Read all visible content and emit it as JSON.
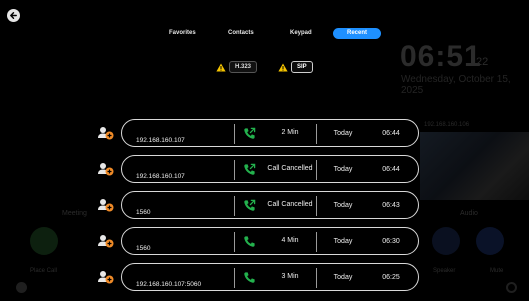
{
  "tabs": [
    {
      "label": "Favorites",
      "active": false
    },
    {
      "label": "Contacts",
      "active": false
    },
    {
      "label": "Keypad",
      "active": false
    },
    {
      "label": "Recent",
      "active": true
    }
  ],
  "protocols": [
    {
      "label": "H.323",
      "selected": false
    },
    {
      "label": "SIP",
      "selected": true
    }
  ],
  "background": {
    "time": "06:51",
    "seconds": "22",
    "date": "Wednesday, October 15, 2025",
    "meeting_label": "Meeting",
    "audio_label": "Audio",
    "ip": "192.168.160.106",
    "left_caption": "Place Call",
    "right_caption_1": "Speaker",
    "right_caption_2": "Mute"
  },
  "calls": [
    {
      "address": "192.168.160.107",
      "duration": "2 Min",
      "day": "Today",
      "time": "06:44",
      "icon": "outgoing-call-icon"
    },
    {
      "address": "192.168.160.107",
      "duration": "Call Cancelled",
      "day": "Today",
      "time": "06:44",
      "icon": "outgoing-call-icon"
    },
    {
      "address": "1560",
      "duration": "Call Cancelled",
      "day": "Today",
      "time": "06:43",
      "icon": "outgoing-call-icon"
    },
    {
      "address": "1560",
      "duration": "4 Min",
      "day": "Today",
      "time": "06:30",
      "icon": "phone-icon"
    },
    {
      "address": "192.168.160.107:5060",
      "duration": "3 Min",
      "day": "Today",
      "time": "06:25",
      "icon": "phone-icon"
    }
  ],
  "colors": {
    "accent": "#1e90ff",
    "call_green": "#23b14d",
    "warning": "#f5c400",
    "add_orange": "#f28c28"
  }
}
